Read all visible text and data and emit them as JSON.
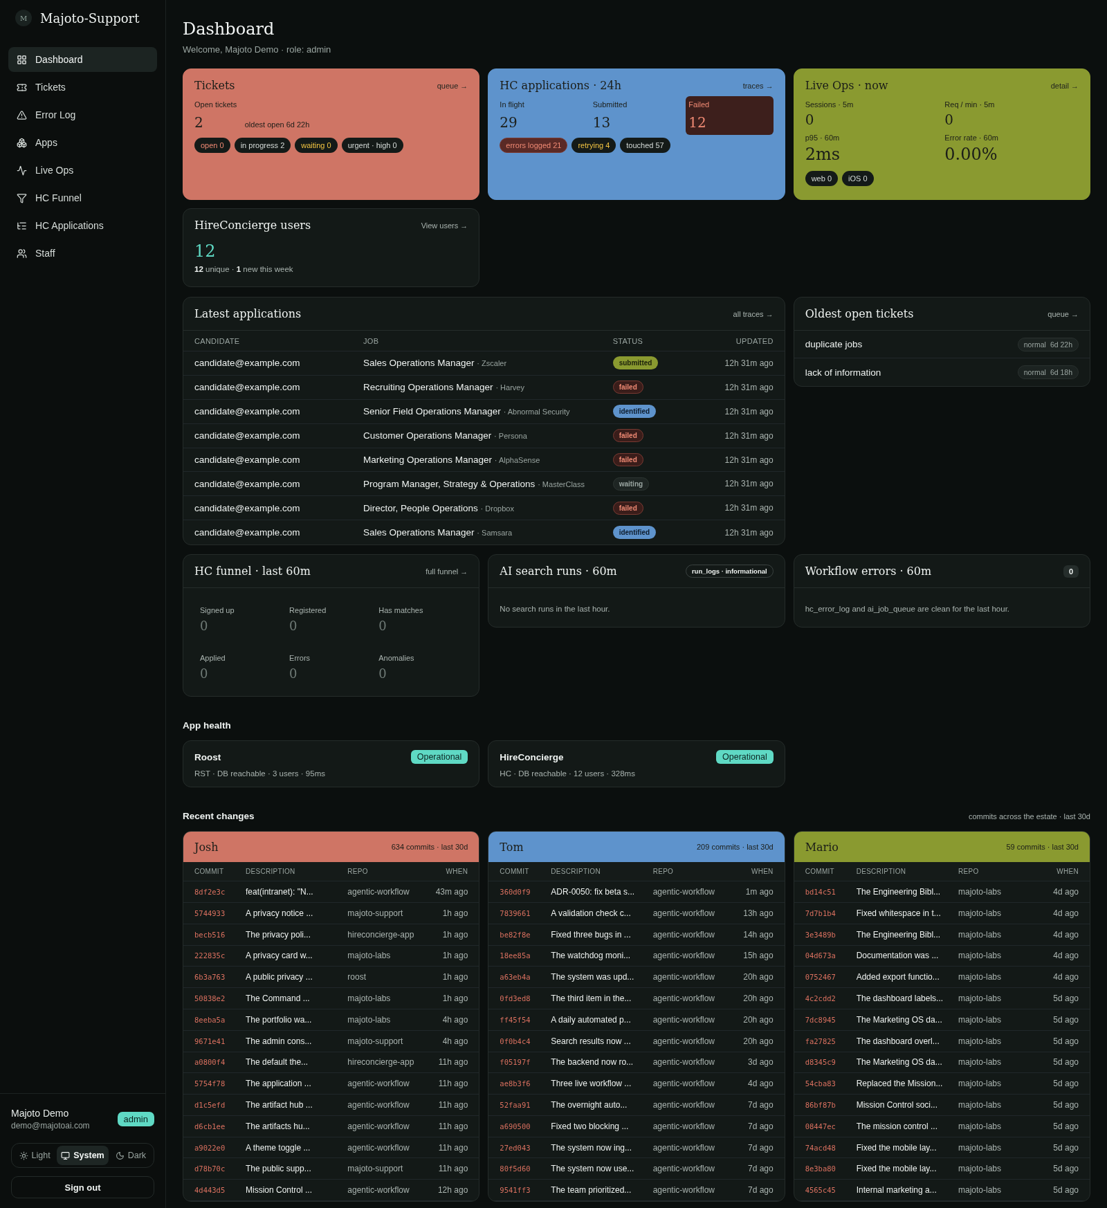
{
  "sidebar": {
    "logo": "M",
    "brand": "Majoto-Support",
    "nav": [
      {
        "label": "Dashboard",
        "kind": "grid",
        "selected": true
      },
      {
        "label": "Tickets",
        "kind": "ticket",
        "selected": false
      },
      {
        "label": "Error Log",
        "kind": "alert",
        "selected": false
      },
      {
        "label": "Apps",
        "kind": "boxes",
        "selected": false
      },
      {
        "label": "Live Ops",
        "kind": "activity",
        "selected": false
      },
      {
        "label": "HC Funnel",
        "kind": "funnel",
        "selected": false
      },
      {
        "label": "HC Applications",
        "kind": "list",
        "selected": false
      },
      {
        "label": "Staff",
        "kind": "users",
        "selected": false
      }
    ],
    "user": {
      "name": "Majoto Demo",
      "email": "demo@majotoai.com",
      "role": "admin"
    },
    "theme": [
      {
        "label": "Light",
        "kind": "sun",
        "selected": false
      },
      {
        "label": "System",
        "kind": "monitor",
        "selected": true
      },
      {
        "label": "Dark",
        "kind": "moon",
        "selected": false
      }
    ],
    "sign_out": "Sign out"
  },
  "header": {
    "title": "Dashboard",
    "subtitle": "Welcome, Majoto Demo · role: admin"
  },
  "tickets": {
    "title": "Tickets",
    "link": "queue →",
    "label": "Open tickets",
    "value": "2",
    "note": "oldest open 6d 22h",
    "pills": [
      {
        "label": "open 0",
        "kind": "alert"
      },
      {
        "label": "in progress 2",
        "kind": "neutral"
      },
      {
        "label": "waiting 0",
        "kind": "warn"
      },
      {
        "label": "urgent · high 0",
        "kind": "neutral"
      }
    ]
  },
  "hc_applications": {
    "title": "HC applications · 24h",
    "link": "traces →",
    "stats": [
      {
        "label": "In flight",
        "value": "29",
        "kind": "normal"
      },
      {
        "label": "Submitted",
        "value": "13",
        "kind": "normal"
      },
      {
        "label": "Failed",
        "value": "12",
        "kind": "alert"
      }
    ],
    "pills": [
      {
        "label": "errors logged 21",
        "kind": "error"
      },
      {
        "label": "retrying 4",
        "kind": "warn"
      },
      {
        "label": "touched 57",
        "kind": "neutral"
      }
    ]
  },
  "live_ops": {
    "title": "Live Ops · now",
    "link": "detail →",
    "stats": [
      {
        "label": "Sessions · 5m",
        "value": "0"
      },
      {
        "label": "Req / min · 5m",
        "value": "0"
      },
      {
        "label": "p95 · 60m",
        "value": "2ms"
      },
      {
        "label": "Error rate · 60m",
        "value": "0.00%"
      }
    ],
    "pills": [
      {
        "label": "web 0",
        "kind": "neutral"
      },
      {
        "label": "iOS 0",
        "kind": "neutral"
      }
    ]
  },
  "users": {
    "title": "HireConcierge users",
    "link": "View users →",
    "value": "12",
    "note": "**12** unique · **1** new this week"
  },
  "latest_applications": {
    "title": "Latest applications",
    "link": "all traces →",
    "columns": [
      "CANDIDATE",
      "JOB",
      "STATUS",
      "UPDATED"
    ],
    "rows": [
      {
        "candidate": "candidate@example.com",
        "job": "Sales Operations Manager",
        "company": "· Zscaler",
        "status": "submitted",
        "kind": "submitted",
        "updated": "12h 31m ago"
      },
      {
        "candidate": "candidate@example.com",
        "job": "Recruiting Operations Manager",
        "company": "· Harvey",
        "status": "failed",
        "kind": "failed",
        "updated": "12h 31m ago"
      },
      {
        "candidate": "candidate@example.com",
        "job": "Senior Field Operations Manager",
        "company": "· Abnormal Security",
        "status": "identified",
        "kind": "identified",
        "updated": "12h 31m ago"
      },
      {
        "candidate": "candidate@example.com",
        "job": "Customer Operations Manager",
        "company": "· Persona",
        "status": "failed",
        "kind": "failed",
        "updated": "12h 31m ago"
      },
      {
        "candidate": "candidate@example.com",
        "job": "Marketing Operations Manager",
        "company": "· AlphaSense",
        "status": "failed",
        "kind": "failed",
        "updated": "12h 31m ago"
      },
      {
        "candidate": "candidate@example.com",
        "job": "Program Manager, Strategy & Operations",
        "company": "· MasterClass",
        "status": "waiting",
        "kind": "waiting",
        "updated": "12h 31m ago"
      },
      {
        "candidate": "candidate@example.com",
        "job": "Director, People Operations",
        "company": "· Dropbox",
        "status": "failed",
        "kind": "failed",
        "updated": "12h 31m ago"
      },
      {
        "candidate": "candidate@example.com",
        "job": "Sales Operations Manager",
        "company": "· Samsara",
        "status": "identified",
        "kind": "identified",
        "updated": "12h 31m ago"
      }
    ]
  },
  "oldest_tickets": {
    "title": "Oldest open tickets",
    "link": "queue →",
    "rows": [
      {
        "title": "duplicate jobs",
        "priority": "normal",
        "age": "6d 22h"
      },
      {
        "title": "lack of information",
        "priority": "normal",
        "age": "6d 18h"
      }
    ]
  },
  "hc_funnel": {
    "title": "HC funnel · last 60m",
    "link": "full funnel →",
    "stats": [
      {
        "label": "Signed up",
        "value": "0"
      },
      {
        "label": "Registered",
        "value": "0"
      },
      {
        "label": "Has matches",
        "value": "0"
      },
      {
        "label": "Applied",
        "value": "0"
      },
      {
        "label": "Errors",
        "value": "0"
      },
      {
        "label": "Anomalies",
        "value": "0"
      }
    ]
  },
  "ai_search": {
    "title": "AI search runs · 60m",
    "badge": "run_logs · informational",
    "message": "No search runs in the last hour."
  },
  "workflow_errors": {
    "title": "Workflow errors · 60m",
    "count": "0",
    "message": "hc_error_log and ai_job_queue are clean for the last hour."
  },
  "app_health": {
    "title": "App health",
    "apps": [
      {
        "name": "Roost",
        "status": "Operational",
        "kind": "ok",
        "detail": "RST · DB reachable · 3 users · 95ms"
      },
      {
        "name": "HireConcierge",
        "status": "Operational",
        "kind": "ok",
        "detail": "HC · DB reachable · 12 users · 328ms"
      }
    ]
  },
  "recent_changes": {
    "title": "Recent changes",
    "note": "commits across the estate · last 30d",
    "authors": [
      {
        "name": "Josh",
        "commits": "634 commits · last 30d",
        "color": "#cf7565",
        "columns": [
          "COMMIT",
          "DESCRIPTION",
          "REPO",
          "WHEN"
        ],
        "rows": [
          [
            "8df2e3c",
            "feat(intranet): \"N...",
            "agentic-workflow",
            "43m ago"
          ],
          [
            "5744933",
            "A privacy notice ...",
            "majoto-support",
            "1h ago"
          ],
          [
            "becb516",
            "The privacy poli...",
            "hireconcierge-app",
            "1h ago"
          ],
          [
            "222835c",
            "A privacy card w...",
            "majoto-labs",
            "1h ago"
          ],
          [
            "6b3a763",
            "A public privacy ...",
            "roost",
            "1h ago"
          ],
          [
            "50838e2",
            "The Command ...",
            "majoto-labs",
            "1h ago"
          ],
          [
            "8eeba5a",
            "The portfolio wa...",
            "majoto-labs",
            "4h ago"
          ],
          [
            "9671e41",
            "The admin cons...",
            "majoto-support",
            "4h ago"
          ],
          [
            "a0800f4",
            "The default the...",
            "hireconcierge-app",
            "11h ago"
          ],
          [
            "5754f78",
            "The application ...",
            "agentic-workflow",
            "11h ago"
          ],
          [
            "d1c5efd",
            "The artifact hub ...",
            "agentic-workflow",
            "11h ago"
          ],
          [
            "d6cb1ee",
            "The artifacts hu...",
            "agentic-workflow",
            "11h ago"
          ],
          [
            "a9022e0",
            "A theme toggle ...",
            "agentic-workflow",
            "11h ago"
          ],
          [
            "d78b70c",
            "The public supp...",
            "majoto-support",
            "11h ago"
          ],
          [
            "4d443d5",
            "Mission Control ...",
            "agentic-workflow",
            "12h ago"
          ]
        ]
      },
      {
        "name": "Tom",
        "commits": "209 commits · last 30d",
        "color": "#5e93cc",
        "columns": [
          "COMMIT",
          "DESCRIPTION",
          "REPO",
          "WHEN"
        ],
        "rows": [
          [
            "360d0f9",
            "ADR-0050: fix beta s...",
            "agentic-workflow",
            "1m ago"
          ],
          [
            "7839661",
            "A validation check c...",
            "agentic-workflow",
            "13h ago"
          ],
          [
            "be82f8e",
            "Fixed three bugs in ...",
            "agentic-workflow",
            "14h ago"
          ],
          [
            "18ee85a",
            "The watchdog moni...",
            "agentic-workflow",
            "15h ago"
          ],
          [
            "a63eb4a",
            "The system was upd...",
            "agentic-workflow",
            "20h ago"
          ],
          [
            "0fd3ed8",
            "The third item in the...",
            "agentic-workflow",
            "20h ago"
          ],
          [
            "ff45f54",
            "A daily automated p...",
            "agentic-workflow",
            "20h ago"
          ],
          [
            "0f0b4c4",
            "Search results now ...",
            "agentic-workflow",
            "20h ago"
          ],
          [
            "f05197f",
            "The backend now ro...",
            "agentic-workflow",
            "3d ago"
          ],
          [
            "ae8b3f6",
            "Three live workflow ...",
            "agentic-workflow",
            "4d ago"
          ],
          [
            "52faa91",
            "The overnight auto...",
            "agentic-workflow",
            "7d ago"
          ],
          [
            "a690500",
            "Fixed two blocking ...",
            "agentic-workflow",
            "7d ago"
          ],
          [
            "27ed043",
            "The system now ing...",
            "agentic-workflow",
            "7d ago"
          ],
          [
            "80f5d60",
            "The system now use...",
            "agentic-workflow",
            "7d ago"
          ],
          [
            "9541ff3",
            "The team prioritized...",
            "agentic-workflow",
            "7d ago"
          ]
        ]
      },
      {
        "name": "Mario",
        "commits": "59 commits · last 30d",
        "color": "#8a9a30",
        "columns": [
          "COMMIT",
          "DESCRIPTION",
          "REPO",
          "WHEN"
        ],
        "rows": [
          [
            "bd14c51",
            "The Engineering Bibl...",
            "majoto-labs",
            "4d ago"
          ],
          [
            "7d7b1b4",
            "Fixed whitespace in t...",
            "majoto-labs",
            "4d ago"
          ],
          [
            "3e3489b",
            "The Engineering Bibl...",
            "majoto-labs",
            "4d ago"
          ],
          [
            "04d673a",
            "Documentation was ...",
            "majoto-labs",
            "4d ago"
          ],
          [
            "0752467",
            "Added export functio...",
            "majoto-labs",
            "4d ago"
          ],
          [
            "4c2cdd2",
            "The dashboard labels...",
            "majoto-labs",
            "5d ago"
          ],
          [
            "7dc8945",
            "The Marketing OS da...",
            "majoto-labs",
            "5d ago"
          ],
          [
            "fa27825",
            "The dashboard overl...",
            "majoto-labs",
            "5d ago"
          ],
          [
            "d8345c9",
            "The Marketing OS da...",
            "majoto-labs",
            "5d ago"
          ],
          [
            "54cba83",
            "Replaced the Mission...",
            "majoto-labs",
            "5d ago"
          ],
          [
            "86bf87b",
            "Mission Control soci...",
            "majoto-labs",
            "5d ago"
          ],
          [
            "08447ec",
            "The mission control ...",
            "majoto-labs",
            "5d ago"
          ],
          [
            "74acd48",
            "Fixed the mobile lay...",
            "majoto-labs",
            "5d ago"
          ],
          [
            "8e3ba80",
            "Fixed the mobile lay...",
            "majoto-labs",
            "5d ago"
          ],
          [
            "4565c45",
            "Internal marketing a...",
            "majoto-labs",
            "5d ago"
          ]
        ]
      }
    ]
  }
}
